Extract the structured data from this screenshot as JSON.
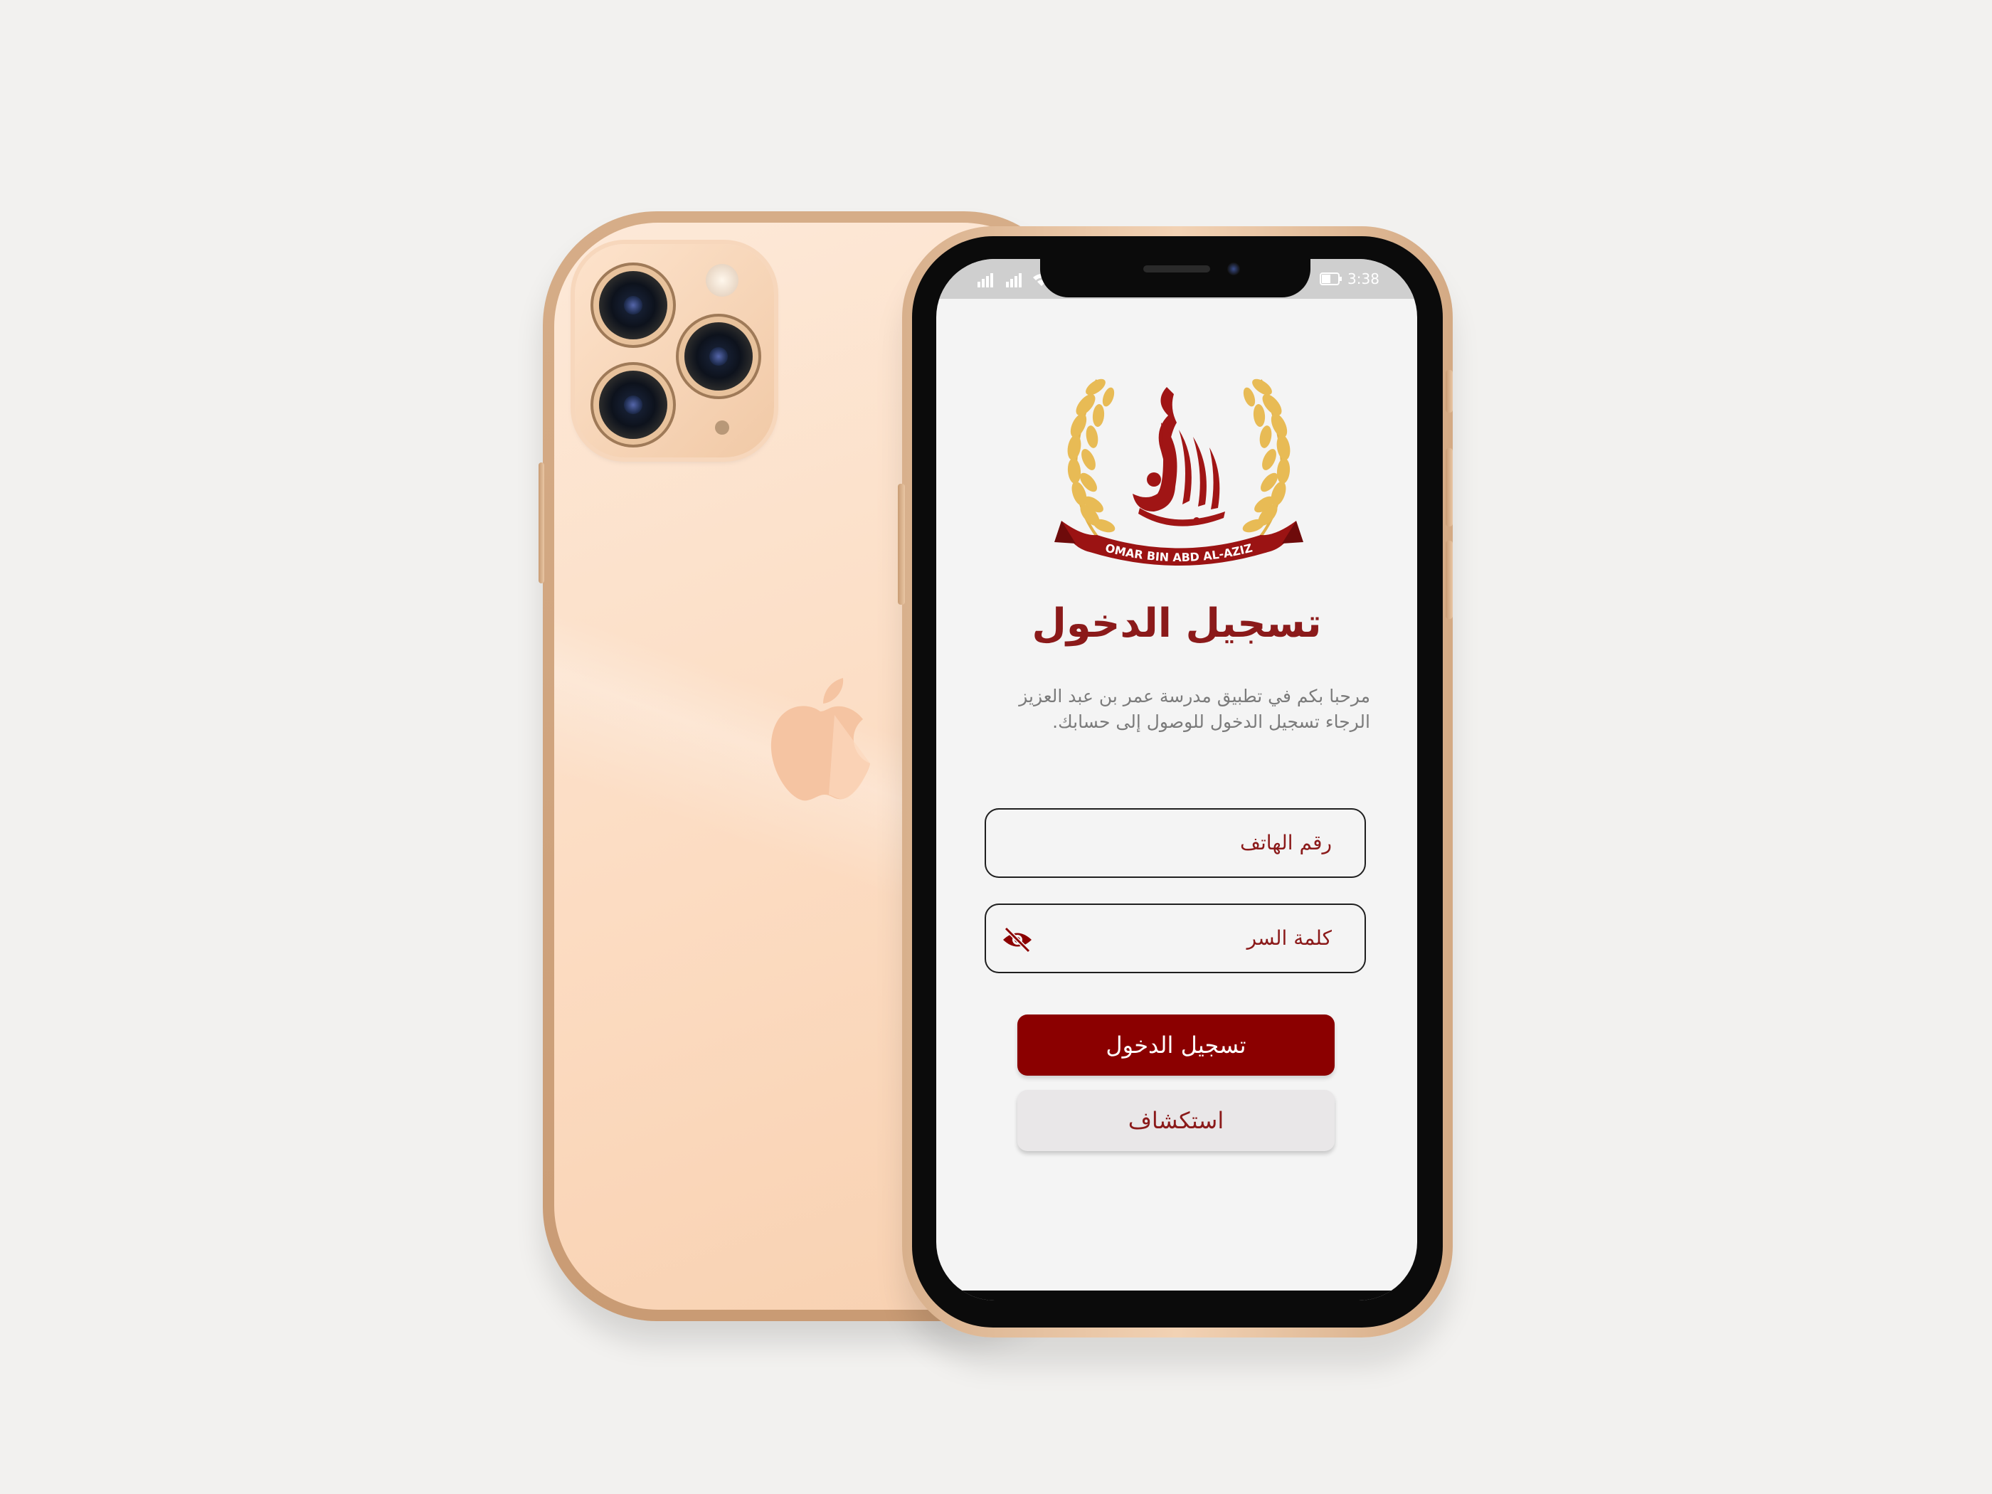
{
  "status_bar": {
    "time": "3:38",
    "battery": "47"
  },
  "app": {
    "logo_text": "OMAR BIN ABD AL-AZIZ",
    "title": "تسجيل الدخول",
    "welcome_line1": "مرحبا بكم في تطبيق مدرسة عمر بن عبد العزيز",
    "welcome_line2": "الرجاء تسجيل الدخول للوصول إلى حسابك.",
    "phone_field": {
      "label": "رقم الهاتف"
    },
    "password_field": {
      "label": "كلمة السر"
    },
    "login_button": "تسجيل الدخول",
    "explore_button": "استكشاف"
  },
  "colors": {
    "brand": "#8b0000",
    "brand_text": "#8b1a1a",
    "background": "#f2f1ef",
    "phone_gold": "#fcdcc2"
  },
  "icons": {
    "eye_toggle": "eye-slash-icon",
    "back_logo": "apple-logo-icon"
  }
}
